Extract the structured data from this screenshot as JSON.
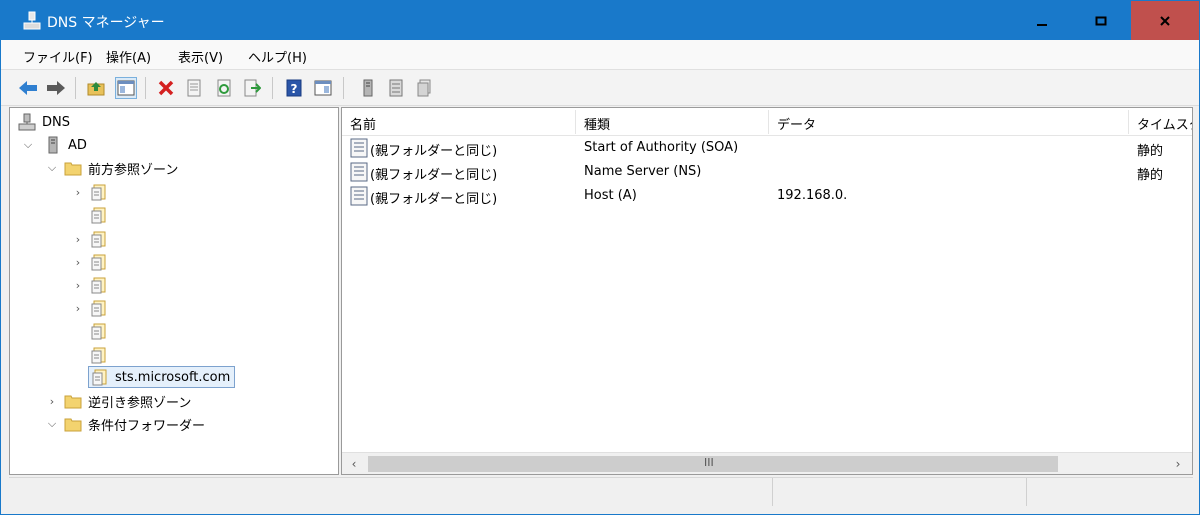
{
  "window": {
    "title": "DNS マネージャー"
  },
  "menu": [
    {
      "label": "ファイル(F)"
    },
    {
      "label": "操作(A)"
    },
    {
      "label": "表示(V)"
    },
    {
      "label": "ヘルプ(H)"
    }
  ],
  "toolbar": {
    "icons": [
      "back-arrow-icon",
      "forward-arrow-icon",
      "up-folder-icon",
      "show-hide-console-tree-icon",
      "delete-icon",
      "properties-icon",
      "refresh-icon",
      "export-list-icon",
      "help-icon",
      "action-pane-icon",
      "server-icon",
      "zone-icon",
      "records-icon"
    ]
  },
  "tree": {
    "root": "DNS",
    "server": "AD",
    "forward_zones": "前方参照ゾーン",
    "selected_zone": "sts.microsoft.com",
    "reverse_zones": "逆引き参照ゾーン",
    "conditional_forwarders": "条件付フォワーダー"
  },
  "list": {
    "columns": [
      "名前",
      "種類",
      "データ",
      "タイムスタ"
    ],
    "rows": [
      {
        "name": "(親フォルダーと同じ)",
        "type": "Start of Authority (SOA)",
        "data": "",
        "timestamp": "静的"
      },
      {
        "name": "(親フォルダーと同じ)",
        "type": "Name Server (NS)",
        "data": "",
        "timestamp": "静的"
      },
      {
        "name": "(親フォルダーと同じ)",
        "type": "Host (A)",
        "data": "192.168.0.",
        "timestamp": ""
      }
    ],
    "scrollbar_center": "III"
  },
  "colors": {
    "titlebar": "#1979ca",
    "close": "#c0504d",
    "selection": "#e5f0fb"
  }
}
